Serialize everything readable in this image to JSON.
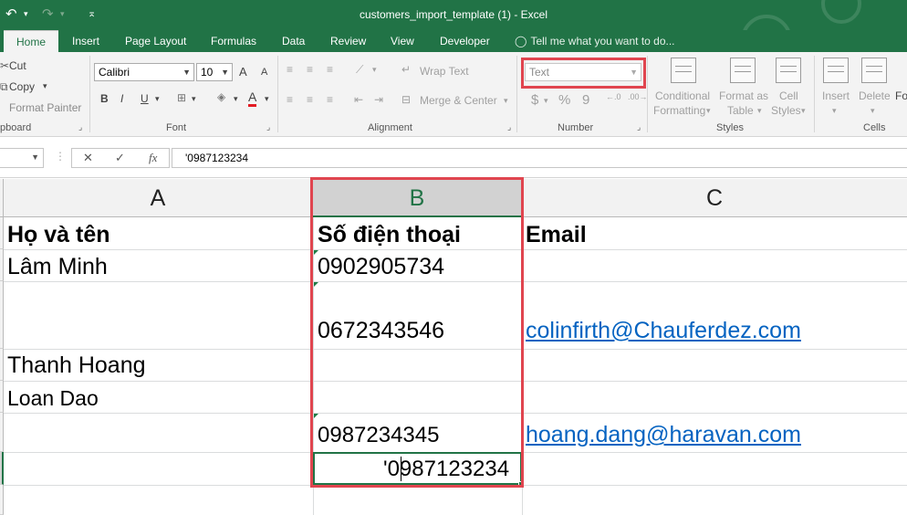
{
  "window": {
    "title": "customers_import_template (1) - Excel"
  },
  "quick_access": {
    "undo": "↶",
    "redo": "↷",
    "customize": "⌅"
  },
  "tabs": [
    "Home",
    "Insert",
    "Page Layout",
    "Formulas",
    "Data",
    "Review",
    "View",
    "Developer"
  ],
  "tell_me": "Tell me what you want to do...",
  "ribbon": {
    "clipboard": {
      "cut": "Cut",
      "copy": "Copy",
      "format_painter": "Format Painter",
      "group": "pboard"
    },
    "font": {
      "name": "Calibri",
      "size": "10",
      "bold": "B",
      "italic": "I",
      "underline": "U",
      "grow": "A",
      "shrink": "A",
      "font_color": "A",
      "group": "Font"
    },
    "alignment": {
      "wrap_text": "Wrap Text",
      "merge_center": "Merge & Center",
      "group": "Alignment"
    },
    "number": {
      "format": "Text",
      "currency": "$",
      "percent": "%",
      "comma": "9",
      "group": "Number"
    },
    "styles": {
      "conditional": "Conditional",
      "formatting": "Formatting",
      "format_as": "Format as",
      "table": "Table",
      "cell": "Cell",
      "styles": "Styles",
      "group": "Styles"
    },
    "cells": {
      "insert": "Insert",
      "delete": "Delete",
      "format": "Fo",
      "group": "Cells"
    }
  },
  "formula_bar": {
    "cancel": "✕",
    "enter": "✓",
    "fx": "fx",
    "value": "'0987123234"
  },
  "columns": [
    "A",
    "B",
    "C"
  ],
  "cells": {
    "A1": "Họ và tên",
    "B1": "Số điện thoại",
    "C1": "Email",
    "A2": "Lâm Minh",
    "B2": "0902905734",
    "B3": "0672343546",
    "C3": "colinfirth@Chauferdez.com",
    "A4": "Thanh Hoang",
    "A5": "Loan Dao",
    "B6": "0987234345",
    "C6": "hoang.dang@haravan.com",
    "B7": "'0987123234"
  },
  "colors": {
    "excel_green": "#217346",
    "highlight_red": "#e0454f",
    "link_blue": "#0563c1"
  }
}
